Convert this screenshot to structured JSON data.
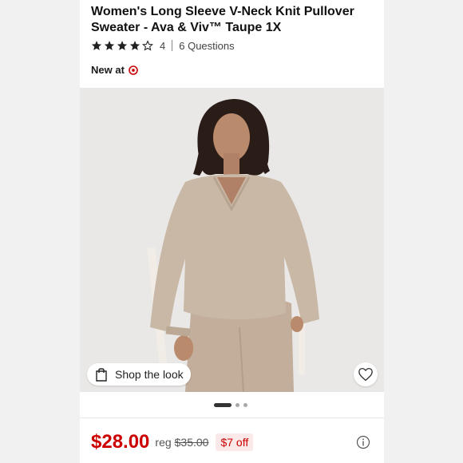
{
  "product": {
    "title": "Women's Long Sleeve V-Neck Knit Pullover Sweater - Ava & Viv™ Taupe 1X",
    "rating": {
      "stars": 4,
      "max": 5,
      "count": "4",
      "questions": "6 Questions"
    },
    "availability_label": "New at",
    "brand_icon": "target-logo-icon"
  },
  "gallery": {
    "shop_the_look": "Shop the look",
    "slides": 3,
    "active_slide": 1
  },
  "pricing": {
    "price": "$28.00",
    "reg_label": "reg",
    "reg_price": "$35.00",
    "discount": "$7 off"
  },
  "colors": {
    "brand_red": "#cc0000",
    "sweater": "#c9b8a6",
    "background": "#e9e8e7"
  }
}
